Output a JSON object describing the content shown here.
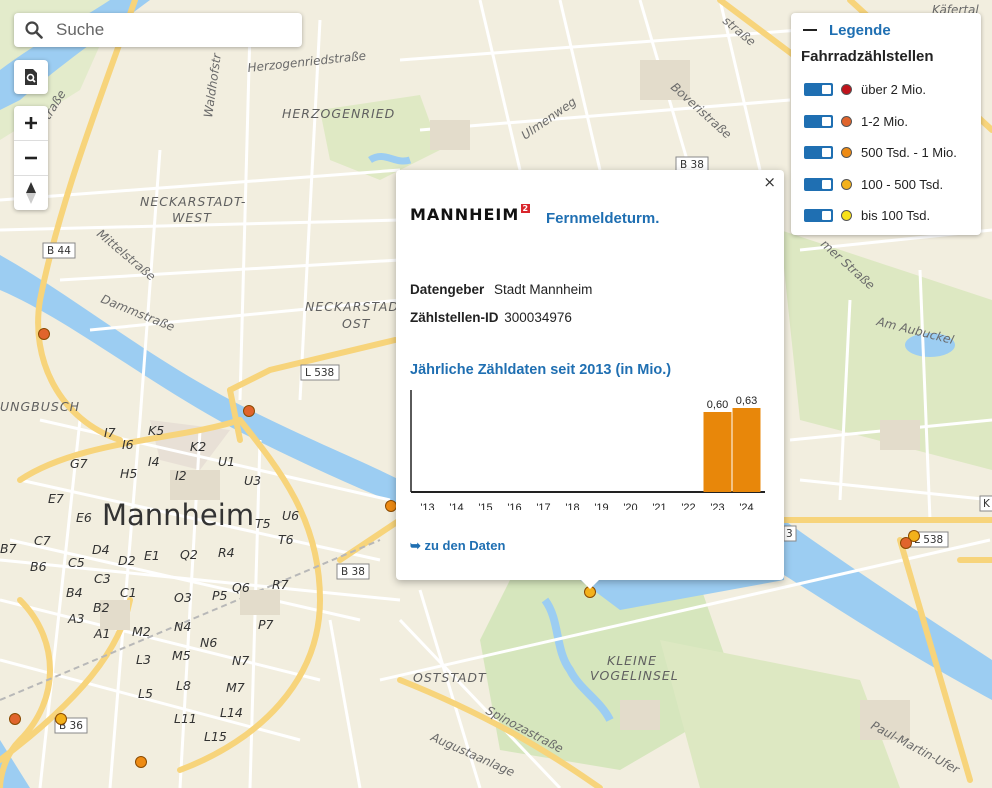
{
  "search": {
    "placeholder": "Suche"
  },
  "map_labels": {
    "districts": [
      "HERZOGENRIED",
      "NECKARSTADT-",
      "WEST",
      "NECKARSTAD",
      "OST",
      "UNGBUSCH",
      "OSTSTADT",
      "KLEINE",
      "VOGELINSEL"
    ],
    "city": "Mannheim",
    "streets": [
      "Herzogenriedstraße",
      "Waldhofstr",
      "Ulmenweg",
      "Boveristraße",
      "Mittelstraße",
      "Dammstraße",
      "Am Aubuckel",
      "Spinozastraße",
      "Augustaanlage",
      "Paul-Martin-Ufer",
      "mer Straße",
      "straße",
      "estraße",
      "Käfertal"
    ],
    "road_shields": [
      "B 38",
      "B 44",
      "L 538",
      "B 38",
      "L 538",
      "B 36",
      "K",
      "3"
    ],
    "grid_blocks": [
      "I7",
      "K5",
      "I6",
      "K2",
      "G7",
      "I4",
      "U1",
      "H5",
      "I2",
      "U3",
      "E7",
      "E6",
      "T5",
      "U6",
      "T6",
      "C7",
      "D4",
      "E1",
      "Q2",
      "R4",
      "B6",
      "C5",
      "D2",
      "C3",
      "Q6",
      "R7",
      "B4",
      "C1",
      "O3",
      "P5",
      "A3",
      "B2",
      "M2",
      "N4",
      "N6",
      "P7",
      "A1",
      "L3",
      "M5",
      "N7",
      "B7",
      "L5",
      "L8",
      "M7",
      "L11",
      "L14",
      "L15"
    ]
  },
  "legend": {
    "title": "Legende",
    "subtitle": "Fahrradzählstellen",
    "items": [
      {
        "label": "über 2 Mio.",
        "color": "#c0131b"
      },
      {
        "label": "1-2 Mio.",
        "color": "#e0642c"
      },
      {
        "label": "500 Tsd. - 1 Mio.",
        "color": "#ee8b14"
      },
      {
        "label": "100 - 500 Tsd.",
        "color": "#f3b11b"
      },
      {
        "label": "bis 100 Tsd.",
        "color": "#f8e11a"
      }
    ]
  },
  "popup": {
    "close": "×",
    "brand": "MANNHEIM",
    "brand_sup": "2",
    "station_name": "Fernmeldeturm.",
    "data_provider_label": "Datengeber",
    "data_provider_value": "Stadt Mannheim",
    "station_id_label": "Zählstellen-ID",
    "station_id_value": "300034976",
    "chart_title": "Jährliche Zähldaten seit 2013 (in Mio.)",
    "link": "➥ zu den Daten"
  },
  "chart_data": {
    "type": "bar",
    "categories": [
      "'13",
      "'14",
      "'15",
      "'16",
      "'17",
      "'18",
      "'19",
      "'20",
      "'21",
      "'22",
      "'23",
      "'24"
    ],
    "values": [
      null,
      null,
      null,
      null,
      null,
      null,
      null,
      null,
      null,
      null,
      0.6,
      0.63
    ],
    "value_labels": [
      "",
      "",
      "",
      "",
      "",
      "",
      "",
      "",
      "",
      "",
      "0,60",
      "0,63"
    ],
    "bar_color": "#e8870a",
    "ylim": [
      0,
      0.75
    ],
    "grid": false
  },
  "markers": [
    {
      "category": "1-2 Mio."
    },
    {
      "category": "100 - 500 Tsd."
    },
    {
      "category": "1-2 Mio."
    },
    {
      "category": "1-2 Mio."
    },
    {
      "category": "100 - 500 Tsd."
    },
    {
      "category": "1-2 Mio."
    },
    {
      "category": "500 Tsd. - 1 Mio."
    },
    {
      "category": "100 - 500 Tsd."
    },
    {
      "category": "500 Tsd. - 1 Mio."
    }
  ]
}
